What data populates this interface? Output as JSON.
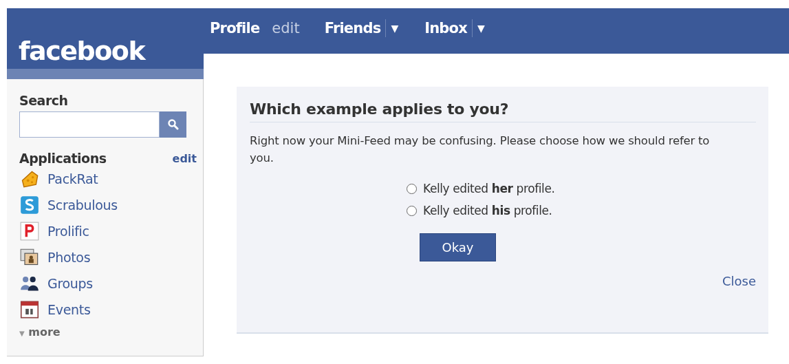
{
  "logo": {
    "text": "facebook"
  },
  "nav": [
    {
      "label": "Profile",
      "kind": "link"
    },
    {
      "label": "edit",
      "kind": "muted"
    },
    {
      "label": "Friends",
      "kind": "menu",
      "arrow": "▼"
    },
    {
      "label": "Inbox",
      "kind": "menu",
      "arrow": "▼"
    }
  ],
  "sidebar": {
    "search": {
      "label": "Search"
    },
    "applications": {
      "title": "Applications",
      "edit": "edit"
    },
    "items": [
      {
        "label": "PackRat",
        "kind": "cheese"
      },
      {
        "label": "Scrabulous",
        "kind": "scrabulous"
      },
      {
        "label": "Prolific",
        "kind": "prolific"
      },
      {
        "label": "Photos",
        "kind": "photos"
      },
      {
        "label": "Groups",
        "kind": "groups"
      },
      {
        "label": "Events",
        "kind": "calendar"
      }
    ],
    "more": {
      "arrow": "▼",
      "label": "more"
    }
  },
  "dialog": {
    "title": "Which example applies to you?",
    "message": "Right now your Mini-Feed may be confusing. Please choose how we should refer to you.",
    "options": [
      {
        "label": "Kelly edited **her** profile.",
        "selected": false
      },
      {
        "label": "Kelly edited **his** profile.",
        "selected": false
      }
    ],
    "button": "Okay",
    "close": "Close"
  }
}
